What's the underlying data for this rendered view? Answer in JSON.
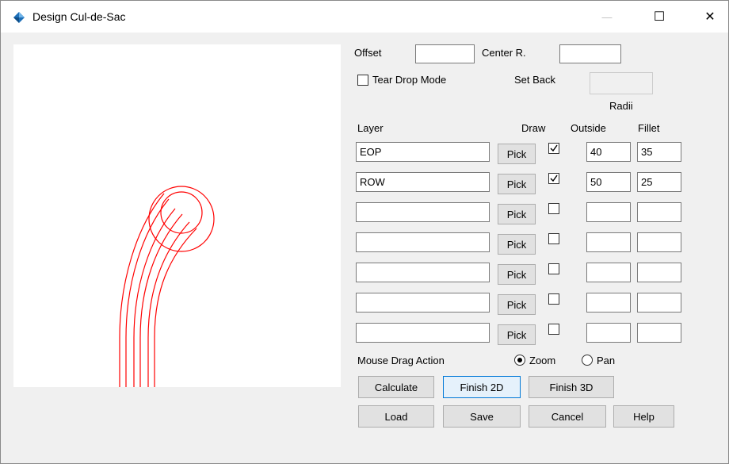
{
  "window": {
    "title": "Design Cul-de-Sac",
    "icon": "autocad-civil-diamond-icon",
    "minimize_symbol": "—",
    "maximize_symbol": "☐",
    "close_symbol": "✕"
  },
  "form": {
    "offset_label": "Offset",
    "offset_value": "",
    "center_r_label": "Center R.",
    "center_r_value": "",
    "tear_drop_label": "Tear Drop Mode",
    "tear_drop_checked": false,
    "set_back_label": "Set Back",
    "set_back_value": "",
    "radii_label": "Radii",
    "headers": {
      "layer": "Layer",
      "draw": "Draw",
      "outside": "Outside",
      "fillet": "Fillet"
    },
    "pick_label": "Pick",
    "rows": [
      {
        "layer": "EOP",
        "draw": true,
        "outside": "40",
        "fillet": "35"
      },
      {
        "layer": "ROW",
        "draw": true,
        "outside": "50",
        "fillet": "25"
      },
      {
        "layer": "",
        "draw": false,
        "outside": "",
        "fillet": ""
      },
      {
        "layer": "",
        "draw": false,
        "outside": "",
        "fillet": ""
      },
      {
        "layer": "",
        "draw": false,
        "outside": "",
        "fillet": ""
      },
      {
        "layer": "",
        "draw": false,
        "outside": "",
        "fillet": ""
      },
      {
        "layer": "",
        "draw": false,
        "outside": "",
        "fillet": ""
      }
    ],
    "mouse_drag_label": "Mouse Drag Action",
    "zoom_label": "Zoom",
    "pan_label": "Pan",
    "drag_mode": "Zoom"
  },
  "buttons": {
    "calculate": "Calculate",
    "finish_2d": "Finish 2D",
    "finish_3d": "Finish 3D",
    "load": "Load",
    "save": "Save",
    "cancel": "Cancel",
    "help": "Help"
  },
  "colors": {
    "preview_lines": "#ff0000",
    "title_icon": "#1d6fb8",
    "focus_border": "#0078d7"
  }
}
